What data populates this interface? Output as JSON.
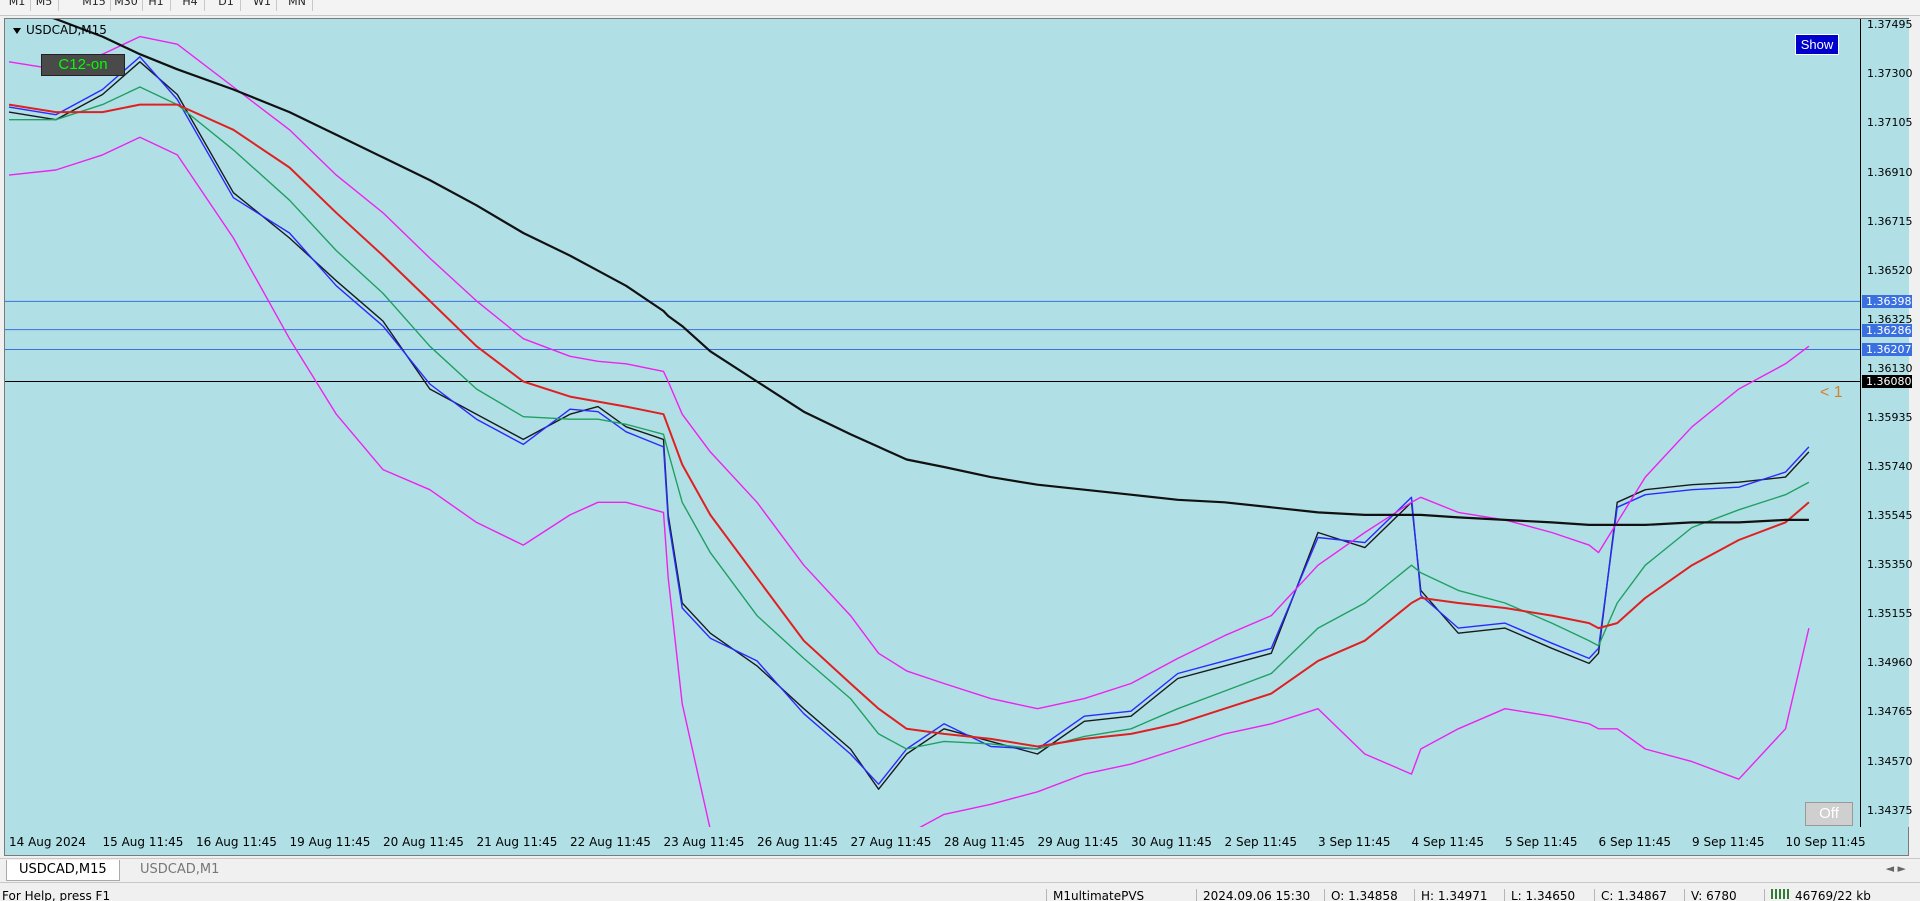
{
  "toolbar": {
    "timeframes": [
      "M1",
      "M5",
      "M15",
      "M30",
      "H1",
      "H4",
      "D1",
      "W1",
      "MN"
    ]
  },
  "chart": {
    "title": "USDCAD,M15",
    "badge_c12": "C12-on",
    "show_button": "Show",
    "off_button": "Off",
    "bars_count": "< 1",
    "background_color": "#b0e0e6",
    "price_axis": {
      "labels": [
        "1.37495",
        "1.37300",
        "1.37105",
        "1.36910",
        "1.36715",
        "1.36520",
        "1.36325",
        "1.36130",
        "1.35935",
        "1.35740",
        "1.35545",
        "1.35350",
        "1.35155",
        "1.34960",
        "1.34765",
        "1.34570",
        "1.34375"
      ],
      "min": 1.3431,
      "max": 1.3752,
      "horizontal_levels": [
        {
          "price": "1.36398",
          "value": 1.36398,
          "color": "#3a6fe0"
        },
        {
          "price": "1.36286",
          "value": 1.36286,
          "color": "#3a6fe0"
        },
        {
          "price": "1.36207",
          "value": 1.36207,
          "color": "#3a6fe0"
        }
      ],
      "current_price": {
        "price": "1.36080",
        "value": 1.3608,
        "color": "#000000"
      }
    },
    "time_axis": {
      "labels": [
        "14 Aug 2024",
        "15 Aug 11:45",
        "16 Aug 11:45",
        "19 Aug 11:45",
        "20 Aug 11:45",
        "21 Aug 11:45",
        "22 Aug 11:45",
        "23 Aug 11:45",
        "26 Aug 11:45",
        "27 Aug 11:45",
        "28 Aug 11:45",
        "29 Aug 11:45",
        "30 Aug 11:45",
        "2 Sep 11:45",
        "3 Sep 11:45",
        "4 Sep 11:45",
        "5 Sep 11:45",
        "6 Sep 11:45",
        "9 Sep 11:45",
        "10 Sep 11:45"
      ]
    }
  },
  "chart_data": {
    "type": "line",
    "x_index": [
      0,
      0.5,
      1,
      1.4,
      1.8,
      2.4,
      3,
      3.5,
      4,
      4.5,
      5,
      5.5,
      6,
      6.3,
      6.6,
      7,
      7.05,
      7.2,
      7.5,
      8,
      8.5,
      9,
      9.3,
      9.6,
      10,
      10.5,
      11,
      11.5,
      12,
      12.5,
      13,
      13.5,
      14,
      14.5,
      15,
      15.1,
      15.5,
      16,
      16.5,
      16.9,
      17,
      17.2,
      17.5,
      18,
      18.5,
      19,
      19.25
    ],
    "series": [
      {
        "color": "#1a1a1a",
        "values": [
          1.3715,
          1.3712,
          1.3722,
          1.3735,
          1.3722,
          1.3683,
          1.3665,
          1.3648,
          1.3632,
          1.3605,
          1.3595,
          1.3585,
          1.3595,
          1.3598,
          1.359,
          1.3585,
          1.3555,
          1.352,
          1.3508,
          1.3495,
          1.3478,
          1.3462,
          1.3446,
          1.346,
          1.347,
          1.3465,
          1.346,
          1.3473,
          1.3475,
          1.349,
          1.3495,
          1.35,
          1.3548,
          1.3542,
          1.356,
          1.3525,
          1.3508,
          1.351,
          1.3502,
          1.3496,
          1.35,
          1.356,
          1.3565,
          1.3567,
          1.3568,
          1.357,
          1.358
        ]
      },
      {
        "color": "#2a2aff",
        "values": [
          1.3717,
          1.3714,
          1.3724,
          1.3737,
          1.372,
          1.3681,
          1.3667,
          1.3646,
          1.363,
          1.3607,
          1.3593,
          1.3583,
          1.3597,
          1.3596,
          1.3588,
          1.3582,
          1.3553,
          1.3518,
          1.3506,
          1.3497,
          1.3476,
          1.346,
          1.3448,
          1.3462,
          1.3472,
          1.3463,
          1.3462,
          1.3475,
          1.3477,
          1.3492,
          1.3497,
          1.3502,
          1.3546,
          1.3544,
          1.3562,
          1.3523,
          1.351,
          1.3512,
          1.3504,
          1.3498,
          1.3502,
          1.3558,
          1.3563,
          1.3565,
          1.3566,
          1.3572,
          1.3582
        ]
      },
      {
        "color": "#20a060",
        "values": [
          1.3712,
          1.3712,
          1.3718,
          1.3725,
          1.3718,
          1.37,
          1.368,
          1.366,
          1.3643,
          1.3622,
          1.3605,
          1.3594,
          1.3593,
          1.3593,
          1.3591,
          1.3587,
          1.358,
          1.356,
          1.354,
          1.3515,
          1.3498,
          1.3482,
          1.3468,
          1.3462,
          1.3465,
          1.3464,
          1.3462,
          1.3467,
          1.347,
          1.3478,
          1.3485,
          1.3492,
          1.351,
          1.352,
          1.3535,
          1.3532,
          1.3525,
          1.352,
          1.3512,
          1.3505,
          1.3503,
          1.352,
          1.3535,
          1.355,
          1.3557,
          1.3563,
          1.3568
        ]
      },
      {
        "color": "#e02020",
        "values": [
          1.3718,
          1.3715,
          1.3715,
          1.3718,
          1.3718,
          1.3708,
          1.3693,
          1.3675,
          1.3658,
          1.364,
          1.3622,
          1.3608,
          1.3602,
          1.36,
          1.3598,
          1.3595,
          1.359,
          1.3575,
          1.3555,
          1.353,
          1.3505,
          1.3488,
          1.3478,
          1.347,
          1.3468,
          1.3466,
          1.3463,
          1.3466,
          1.3468,
          1.3472,
          1.3478,
          1.3484,
          1.3497,
          1.3505,
          1.352,
          1.3522,
          1.352,
          1.3518,
          1.3515,
          1.3512,
          1.351,
          1.3512,
          1.3522,
          1.3535,
          1.3545,
          1.3552,
          1.356
        ]
      },
      {
        "color": "#ee22ee",
        "values": [
          1.3735,
          1.3732,
          1.3738,
          1.3745,
          1.3742,
          1.3725,
          1.3708,
          1.369,
          1.3675,
          1.3657,
          1.364,
          1.3625,
          1.3618,
          1.3616,
          1.3615,
          1.3612,
          1.3608,
          1.3595,
          1.358,
          1.356,
          1.3535,
          1.3515,
          1.35,
          1.3493,
          1.3488,
          1.3482,
          1.3478,
          1.3482,
          1.3488,
          1.3498,
          1.3507,
          1.3515,
          1.3535,
          1.3548,
          1.356,
          1.3562,
          1.3556,
          1.3553,
          1.3548,
          1.3543,
          1.354,
          1.3552,
          1.357,
          1.359,
          1.3605,
          1.3615,
          1.3622
        ]
      },
      {
        "color": "#ee22ee",
        "values": [
          1.369,
          1.3692,
          1.3698,
          1.3705,
          1.3698,
          1.3665,
          1.3625,
          1.3595,
          1.3573,
          1.3565,
          1.3552,
          1.3543,
          1.3555,
          1.356,
          1.356,
          1.3556,
          1.353,
          1.348,
          1.343,
          1.3405,
          1.34,
          1.341,
          1.3418,
          1.3428,
          1.3436,
          1.344,
          1.3445,
          1.3452,
          1.3456,
          1.3462,
          1.3468,
          1.3472,
          1.3478,
          1.346,
          1.3452,
          1.3462,
          1.347,
          1.3478,
          1.3475,
          1.3472,
          1.347,
          1.347,
          1.3462,
          1.3457,
          1.345,
          1.347,
          1.351
        ]
      },
      {
        "color": "#111111",
        "values": [
          1.3758,
          1.3752,
          1.3745,
          1.3738,
          1.3732,
          1.3724,
          1.3715,
          1.3706,
          1.3697,
          1.3688,
          1.3678,
          1.3667,
          1.3658,
          1.3652,
          1.3646,
          1.3636,
          1.3634,
          1.363,
          1.362,
          1.3608,
          1.3596,
          1.3587,
          1.3582,
          1.3577,
          1.3574,
          1.357,
          1.3567,
          1.3565,
          1.3563,
          1.3561,
          1.356,
          1.3558,
          1.3556,
          1.3555,
          1.3555,
          1.3555,
          1.3554,
          1.3553,
          1.3552,
          1.3551,
          1.3551,
          1.3551,
          1.3551,
          1.3552,
          1.3552,
          1.3553,
          1.3553
        ]
      }
    ]
  },
  "tabs": [
    {
      "label": "USDCAD,M15",
      "active": true
    },
    {
      "label": "USDCAD,M1",
      "active": false
    }
  ],
  "tab_scroll": "◄ ►",
  "status_bar": {
    "help": "For Help, press F1",
    "profile": "M1ultimatePVS",
    "datetime": "2024.09.06 15:30",
    "open": "O: 1.34858",
    "high": "H: 1.34971",
    "low": "L: 1.34650",
    "close": "C: 1.34867",
    "volume": "V: 6780",
    "connection": "46769/22 kb"
  }
}
